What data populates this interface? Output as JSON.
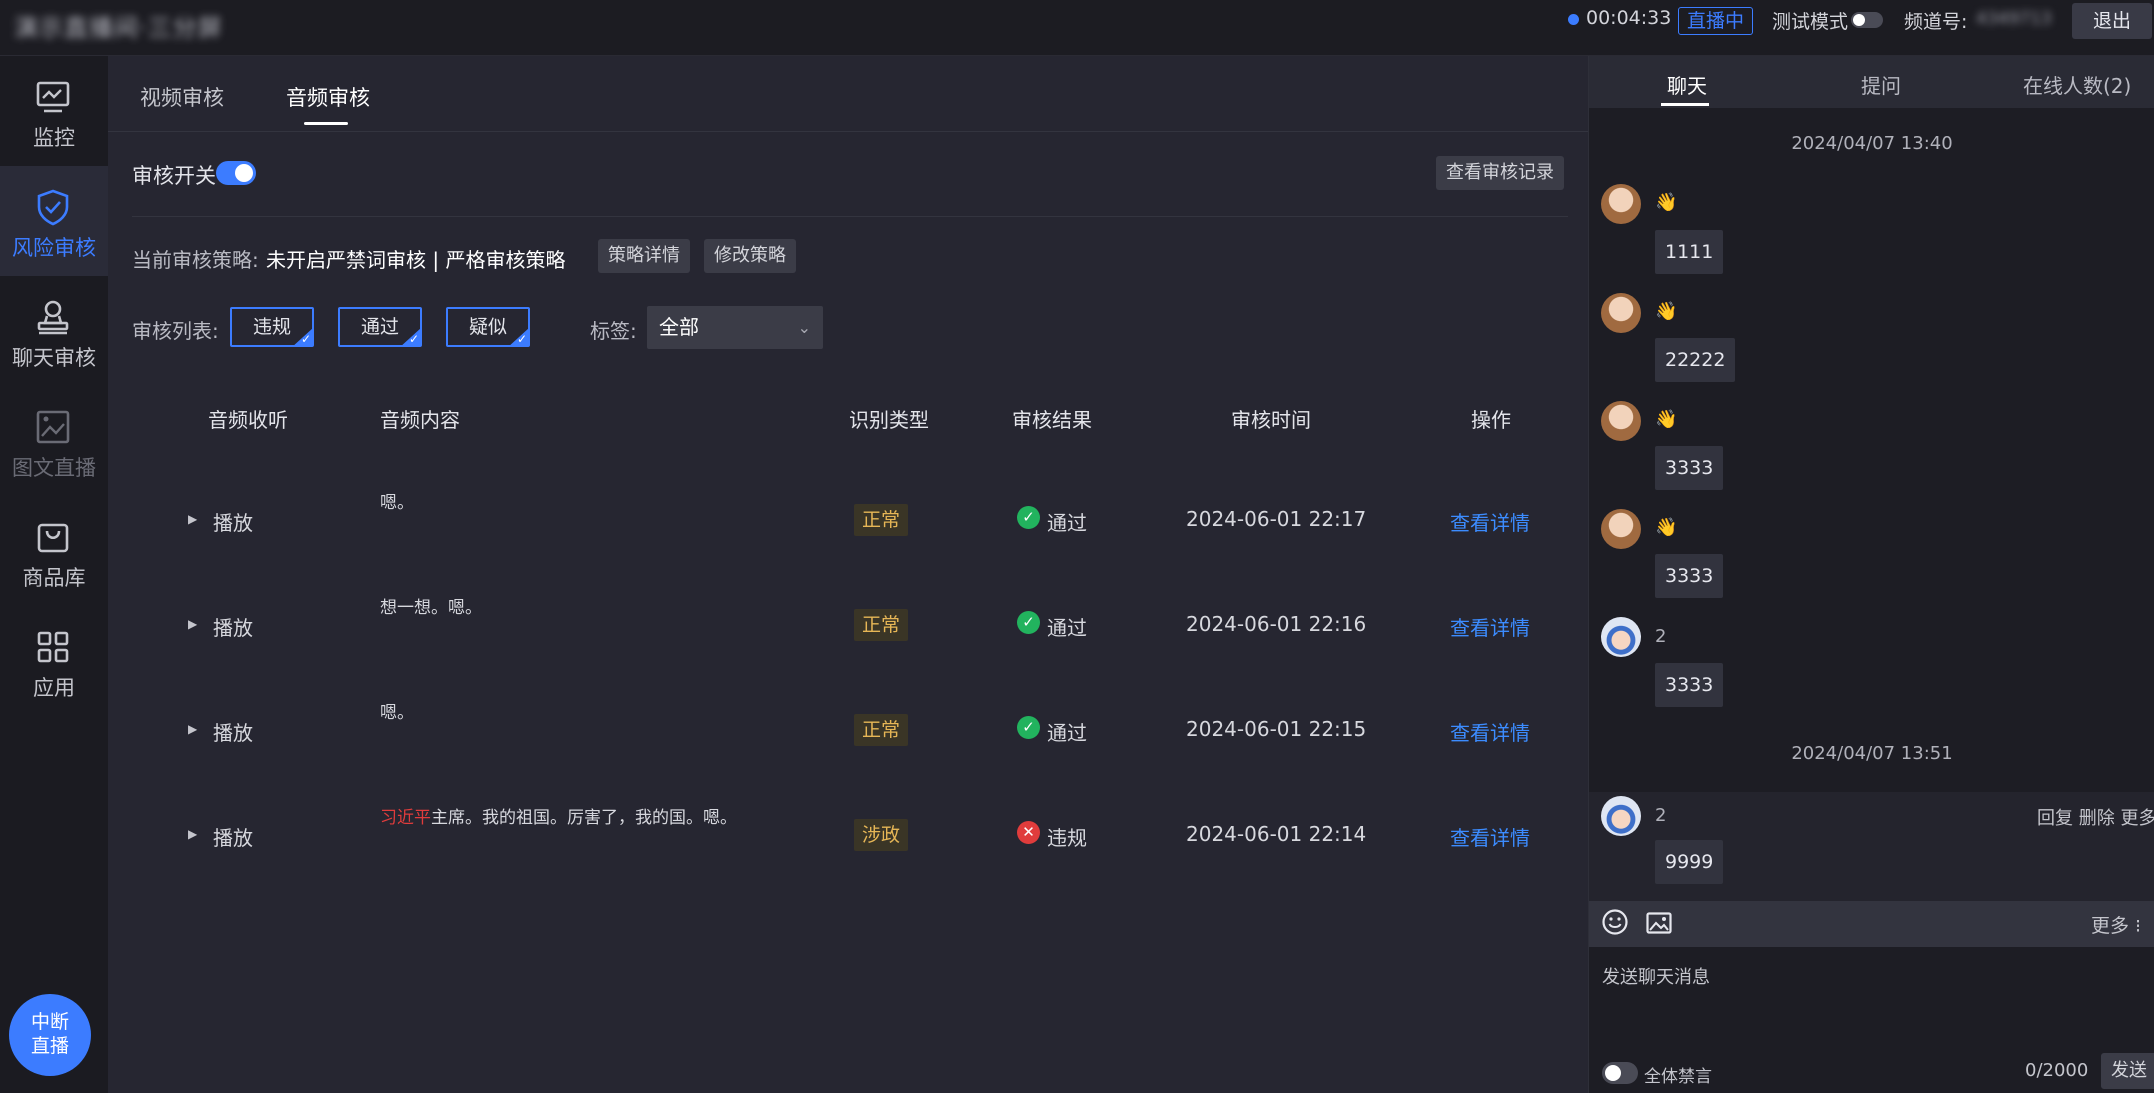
{
  "topbar": {
    "app_title": "演示直播间·三分屏",
    "timer": "00:04:33",
    "live_badge": "直播中",
    "test_mode_label": "测试模式",
    "channel_label": "频道号:",
    "channel_value": "4349713",
    "logout_label": "退出"
  },
  "sidebar": {
    "items": [
      {
        "label": "监控",
        "icon": "monitor-icon"
      },
      {
        "label": "风险审核",
        "icon": "shield-icon"
      },
      {
        "label": "聊天审核",
        "icon": "user-stamp-icon"
      },
      {
        "label": "图文直播",
        "icon": "image-text-icon"
      },
      {
        "label": "商品库",
        "icon": "shopping-bag-icon"
      },
      {
        "label": "应用",
        "icon": "apps-grid-icon"
      }
    ],
    "active_index": 1,
    "stop_live_label": "中断直播",
    "stop_live_line1": "中断",
    "stop_live_line2": "直播"
  },
  "main": {
    "tabs": [
      {
        "label": "视频审核"
      },
      {
        "label": "音频审核"
      }
    ],
    "active_tab": 1,
    "switch_label": "审核开关",
    "switch_on": true,
    "log_button": "查看审核记录",
    "policy_label": "当前审核策略:",
    "policy_value": "未开启严禁词审核 | 严格审核策略",
    "policy_detail_button": "策略详情",
    "policy_edit_button": "修改策略",
    "list_label": "审核列表:",
    "filters": [
      {
        "label": "违规",
        "checked": true
      },
      {
        "label": "通过",
        "checked": true
      },
      {
        "label": "疑似",
        "checked": true
      }
    ],
    "tag_label": "标签:",
    "tag_value": "全部",
    "table": {
      "headers": [
        "音频收听",
        "音频内容",
        "识别类型",
        "审核结果",
        "审核时间",
        "操作"
      ],
      "rows": [
        {
          "play": "播放",
          "content_hl": "",
          "content": "嗯。",
          "type": "正常",
          "result": "通过",
          "result_status": "pass",
          "time": "2024-06-01 22:17",
          "action": "查看详情"
        },
        {
          "play": "播放",
          "content_hl": "",
          "content": "想一想。嗯。",
          "type": "正常",
          "result": "通过",
          "result_status": "pass",
          "time": "2024-06-01 22:16",
          "action": "查看详情"
        },
        {
          "play": "播放",
          "content_hl": "",
          "content": "嗯。",
          "type": "正常",
          "result": "通过",
          "result_status": "pass",
          "time": "2024-06-01 22:15",
          "action": "查看详情"
        },
        {
          "play": "播放",
          "content_hl": "习近平",
          "content": "主席。我的祖国。厉害了，我的国。嗯。",
          "type": "涉政",
          "result": "违规",
          "result_status": "fail",
          "time": "2024-06-01 22:14",
          "action": "查看详情"
        }
      ]
    }
  },
  "chat": {
    "tabs": [
      {
        "label": "聊天"
      },
      {
        "label": "提问"
      },
      {
        "label": "在线人数(2)"
      }
    ],
    "active_tab": 0,
    "time1": "2024/04/07 13:40",
    "time2": "2024/04/07 13:51",
    "messages": [
      {
        "name": "👋",
        "text": "1111",
        "avatar": "girl-avatar"
      },
      {
        "name": "👋",
        "text": "22222",
        "avatar": "girl-avatar"
      },
      {
        "name": "👋",
        "text": "3333",
        "avatar": "girl-avatar"
      },
      {
        "name": "👋",
        "text": "3333",
        "avatar": "girl-avatar"
      },
      {
        "name": "2",
        "text": "3333",
        "avatar": "boy-avatar"
      },
      {
        "name": "2",
        "text": "9999",
        "avatar": "boy-avatar"
      }
    ],
    "msg_actions": "回复 删除 更多",
    "toolbar_more": "更多 ⁝",
    "input_placeholder": "发送聊天消息",
    "mute_all_label": "全体禁言",
    "counter": "0/2000",
    "send_label": "发送"
  },
  "colors": {
    "accent": "#3c7cff",
    "pass": "#22b35e",
    "fail": "#e03c3c",
    "tag_text": "#e6b656",
    "background": "#262631"
  }
}
